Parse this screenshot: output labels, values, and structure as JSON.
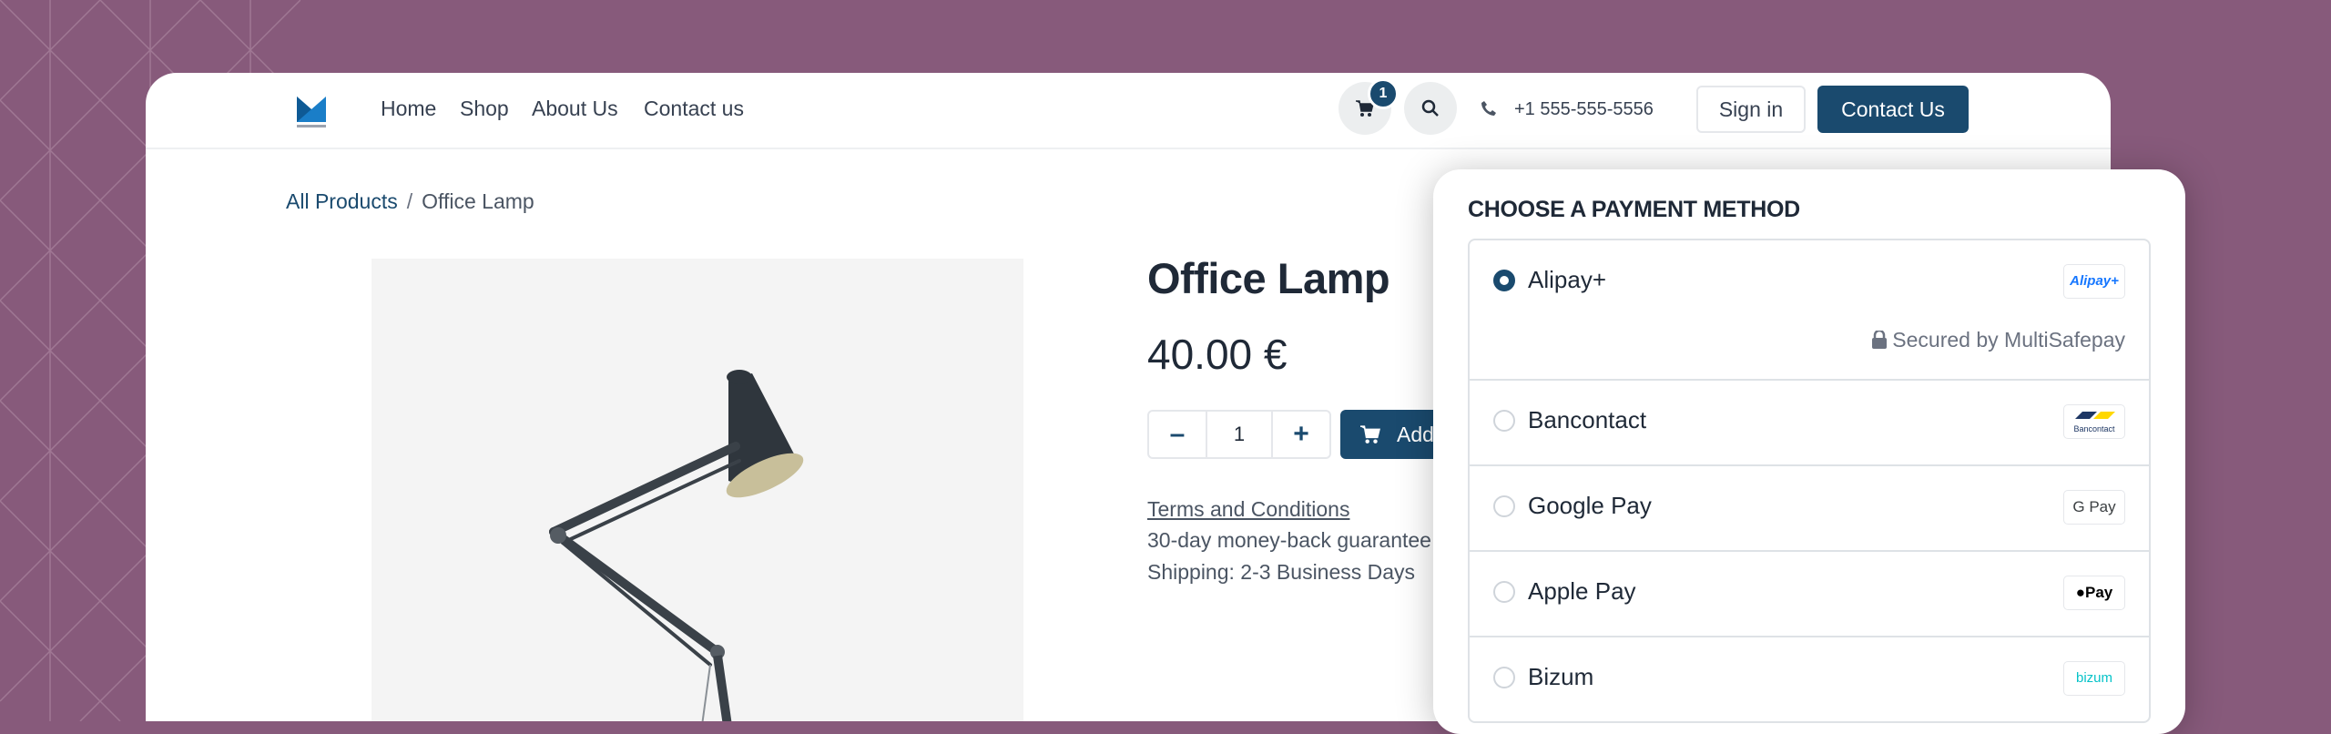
{
  "nav": {
    "links": [
      "Home",
      "Shop",
      "About Us",
      "Contact us"
    ],
    "cart_count": "1",
    "phone": "+1 555-555-5556",
    "sign_in": "Sign in",
    "contact_button": "Contact Us"
  },
  "breadcrumb": {
    "parent": "All Products",
    "separator": "/",
    "current": "Office Lamp"
  },
  "product": {
    "title": "Office Lamp",
    "price": "40.00 €",
    "quantity": "1",
    "add_button": "Add",
    "terms": "Terms and Conditions",
    "guarantee": "30-day money-back guarantee",
    "shipping": "Shipping: 2-3 Business Days"
  },
  "payment": {
    "title": "CHOOSE A PAYMENT METHOD",
    "secured_text": "Secured by MultiSafepay",
    "methods": [
      {
        "name": "Alipay+",
        "logo": "Alipay+",
        "selected": true
      },
      {
        "name": "Bancontact",
        "logo": "Bancontact",
        "selected": false
      },
      {
        "name": "Google Pay",
        "logo": "G Pay",
        "selected": false
      },
      {
        "name": "Apple Pay",
        "logo": "Pay",
        "selected": false
      },
      {
        "name": "Bizum",
        "logo": "bizum",
        "selected": false
      }
    ]
  },
  "colors": {
    "background": "#875a7b",
    "primary": "#1a4a6e",
    "text": "#1f2937"
  }
}
